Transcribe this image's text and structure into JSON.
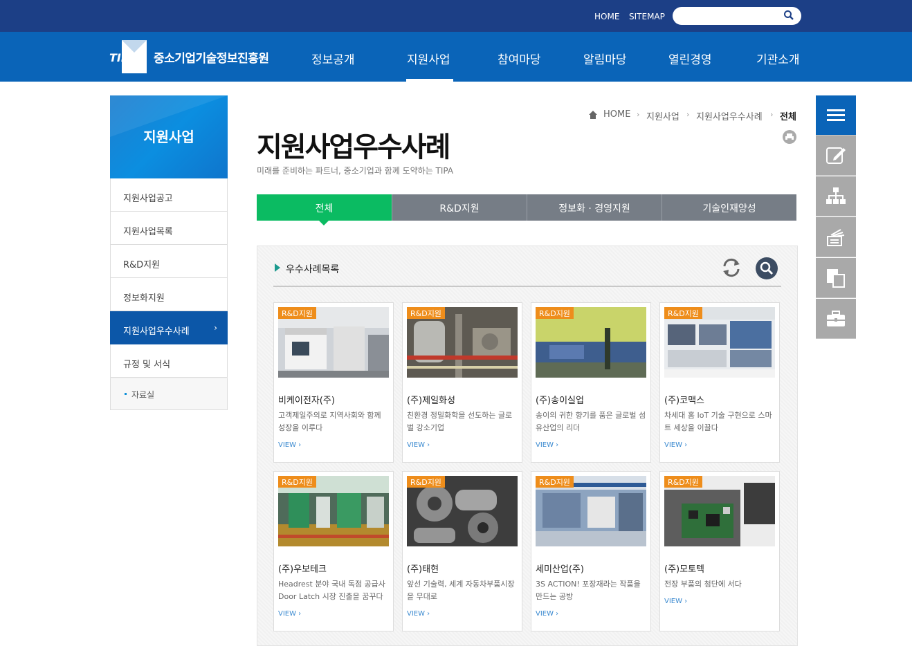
{
  "topbar": {
    "home": "HOME",
    "sitemap": "SITEMAP",
    "search_placeholder": ""
  },
  "brand": {
    "logo_letters": "TIPA",
    "name": "중소기업기술정보진흥원"
  },
  "menu": [
    "정보공개",
    "지원사업",
    "참여마당",
    "알림마당",
    "열린경영",
    "기관소개"
  ],
  "sidebar": {
    "title": "지원사업",
    "items": [
      {
        "label": "지원사업공고"
      },
      {
        "label": "지원사업목록"
      },
      {
        "label": "R&D지원"
      },
      {
        "label": "정보화지원"
      },
      {
        "label": "지원사업우수사례",
        "arrow": "›"
      },
      {
        "label": "규정 및 서식"
      }
    ],
    "sub": "자료실"
  },
  "breadcrumb": {
    "home": "HOME",
    "level1": "지원사업",
    "level2": "지원사업우수사례",
    "current": "전체"
  },
  "page": {
    "title": "지원사업우수사례",
    "subtitle": "미래를 준비하는 파트너, 중소기업과 함께 도약하는 TIPA"
  },
  "tabs": [
    "전체",
    "R&D지원",
    "정보화 · 경영지원",
    "기술인재양성"
  ],
  "list": {
    "title": "우수사례목록"
  },
  "cards": [
    {
      "tag": "R&D지원",
      "name": "비케이전자(주)",
      "desc": "고객제일주의로 지역사회와 함께 성장을 이루다",
      "view": "VIEW ›"
    },
    {
      "tag": "R&D지원",
      "name": "(주)제일화성",
      "desc": "친환경 정밀화학을 선도하는 글로벌 강소기업",
      "view": "VIEW ›"
    },
    {
      "tag": "R&D지원",
      "name": "(주)송이실업",
      "desc": "송이의 귀한 향기를 품은 글로벌 섬유산업의 리더",
      "view": "VIEW ›"
    },
    {
      "tag": "R&D지원",
      "name": "(주)코맥스",
      "desc": "차세대 홈 IoT 기술 구현으로 스마트 세상을 이끌다",
      "view": "VIEW ›"
    },
    {
      "tag": "R&D지원",
      "name": "(주)우보테크",
      "desc": "Headrest 분야 국내 독점 공급사 Door Latch 시장 진출을 꿈꾸다",
      "view": "VIEW ›"
    },
    {
      "tag": "R&D지원",
      "name": "(주)태현",
      "desc": "앞선 기술력, 세계 자동차부품시장을 무대로",
      "view": "VIEW ›"
    },
    {
      "tag": "R&D지원",
      "name": "세미산업(주)",
      "desc": "3S ACTION! 포장재라는 작품을 만드는 공방",
      "view": "VIEW ›"
    },
    {
      "tag": "R&D지원",
      "name": "(주)모토텍",
      "desc": "전장 부품의 첨단에 서다",
      "view": "VIEW ›"
    }
  ],
  "quick_menu": [
    "menu-icon",
    "edit-icon",
    "sitemap-icon",
    "document-stack-icon",
    "copy-icon",
    "briefcase-icon"
  ],
  "colors": {
    "topbar": "#1c3f86",
    "nav": "#0a64b8",
    "tab_active": "#0bbb62",
    "tag": "#ee8d1b"
  }
}
